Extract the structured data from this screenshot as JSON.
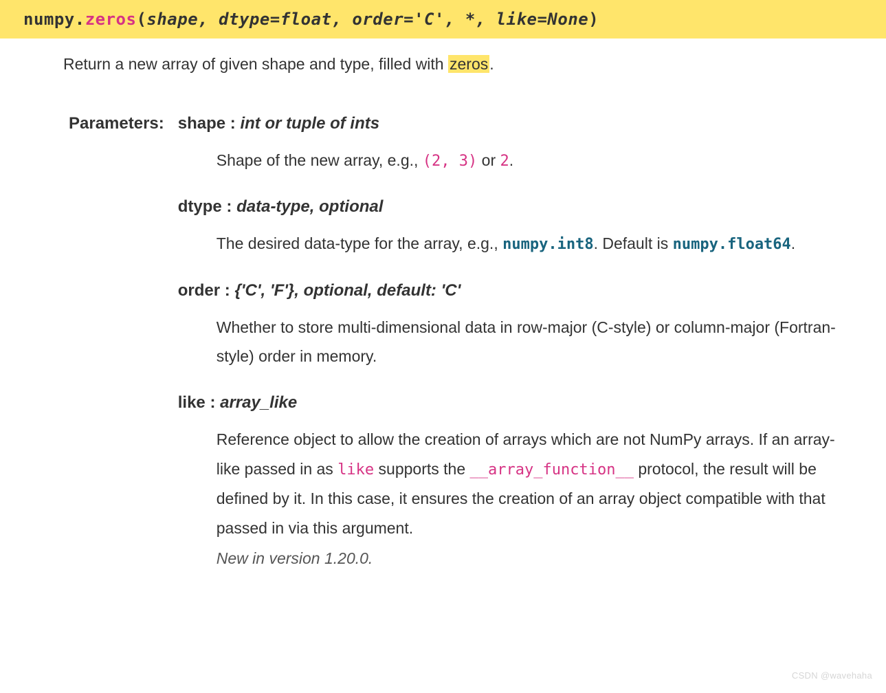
{
  "signature": {
    "prename": "numpy.",
    "name": "zeros",
    "open": "(",
    "params": "shape, dtype=float, order='C', *, like=None",
    "close": ")"
  },
  "description": {
    "pre": "Return a new array of given shape and type, filled with ",
    "highlight": "zeros",
    "post": "."
  },
  "parameters_label": "Parameters:",
  "params": {
    "shape": {
      "name": "shape",
      "sep": " : ",
      "type": "int or tuple of ints",
      "desc_pre": "Shape of the new array, e.g., ",
      "code1": "(2, 3)",
      "desc_mid": " or ",
      "code2": "2",
      "desc_post": "."
    },
    "dtype": {
      "name": "dtype",
      "sep": " : ",
      "type": "data-type, optional",
      "desc_pre": "The desired data-type for the array, e.g., ",
      "code1": "numpy.int8",
      "desc_mid": ". Default is ",
      "code2": "numpy.float64",
      "desc_post": "."
    },
    "order": {
      "name": "order",
      "sep": " : ",
      "type": "{'C', 'F'}, optional, default: 'C'",
      "desc": "Whether to store multi-dimensional data in row-major (C-style) or column-major (Fortran-style) order in memory."
    },
    "like": {
      "name": "like",
      "sep": " : ",
      "type": "array_like",
      "desc_pre": "Reference object to allow the creation of arrays which are not NumPy arrays. If an array-like passed in as ",
      "code1": "like",
      "desc_mid": " supports the ",
      "code2": "__array_function__",
      "desc_post": " protocol, the result will be defined by it. In this case, it ensures the creation of an array object compatible with that passed in via this argument.",
      "versionadded": "New in version 1.20.0."
    }
  },
  "watermark": "CSDN @wavehaha"
}
